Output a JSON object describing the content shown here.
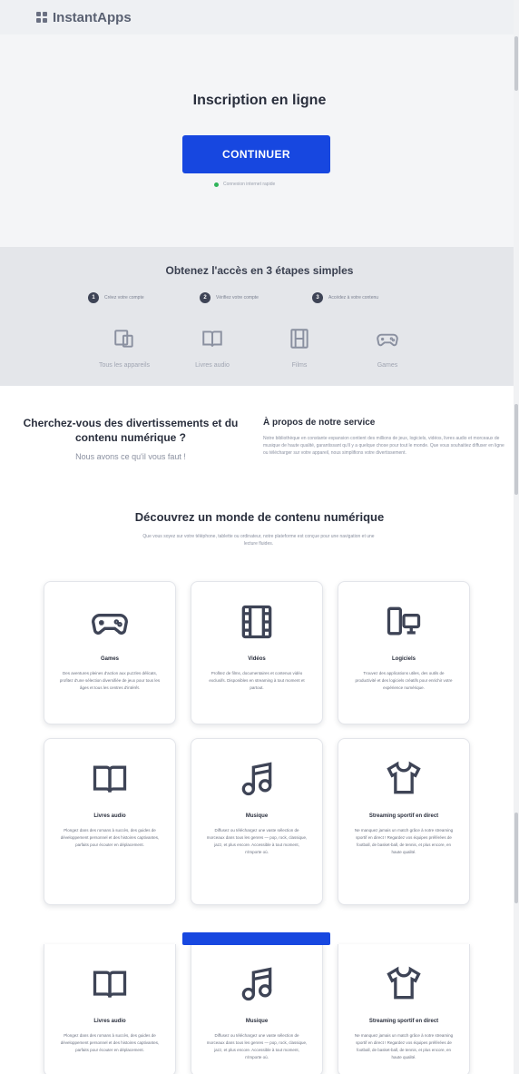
{
  "app": {
    "name": "InstantApps"
  },
  "hero": {
    "title": "Inscription en ligne",
    "cta_label": "CONTINUER",
    "status_text": "Connexion internet rapide"
  },
  "steps": {
    "title": "Obtenez l'accès en 3 étapes simples",
    "items": [
      {
        "num": "1",
        "label": "Créez votre compte"
      },
      {
        "num": "2",
        "label": "Vérifiez votre compte"
      },
      {
        "num": "3",
        "label": "Accédez à votre contenu"
      }
    ],
    "categories": [
      {
        "label": "Tous les appareils",
        "icon": "devices-icon"
      },
      {
        "label": "Livres audio",
        "icon": "book-icon"
      },
      {
        "label": "Films",
        "icon": "film-icon"
      },
      {
        "label": "Games",
        "icon": "gamepad-icon"
      }
    ]
  },
  "intro": {
    "title": "Cherchez-vous des divertissements et du contenu numérique ?",
    "subtitle": "Nous avons ce qu'il vous faut !",
    "about_title": "À propos de notre service",
    "about_text": "Notre bibliothèque en constante expansion contient des millions de jeux, logiciels, vidéos, livres audio et morceaux de musique de haute qualité, garantissant qu'il y a quelque chose pour tout le monde. Que vous souhaitiez diffuser en ligne ou télécharger sur votre appareil, nous simplifions votre divertissement."
  },
  "discover": {
    "title": "Découvrez un monde de contenu numérique",
    "subtitle": "Que vous soyez sur votre téléphone, tablette ou ordinateur, notre plateforme est conçue pour une navigation et une lecture fluides."
  },
  "cards": [
    {
      "icon": "gamepad-icon",
      "title": "Games",
      "text": "Des aventures pleines d'action aux puzzles délicats, profitez d'une sélection diversifiée de jeux pour tous les âges et tous les centres d'intérêt."
    },
    {
      "icon": "film-icon",
      "title": "Vidéos",
      "text": "Profitez de films, documentaires et contenus vidéo exclusifs. Disponibles en streaming à tout moment et partout."
    },
    {
      "icon": "devices-icon",
      "title": "Logiciels",
      "text": "Trouvez des applications utiles, des outils de productivité et des logiciels créatifs pour enrichir votre expérience numérique."
    },
    {
      "icon": "book-icon",
      "title": "Livres audio",
      "text": "Plongez dans des romans à succès, des guides de développement personnel et des histoires captivantes, parfaits pour écouter en déplacement."
    },
    {
      "icon": "music-icon",
      "title": "Musique",
      "text": "Diffusez ou téléchargez une vaste sélection de morceaux dans tous les genres — pop, rock, classique, jazz, et plus encore. Accessible à tout moment, n'importe où."
    },
    {
      "icon": "shirt-icon",
      "title": "Streaming sportif en direct",
      "text": "Ne manquez jamais un match grâce à notre streaming sportif en direct ! Regardez vos équipes préférées de football, de basket-ball, de tennis, et plus encore, en haute qualité."
    },
    {
      "icon": "book-icon",
      "title": "Livres audio",
      "text": "Plongez dans des romans à succès, des guides de développement personnel et des histoires captivantes, parfaits pour écouter en déplacement."
    },
    {
      "icon": "music-icon",
      "title": "Musique",
      "text": "Diffusez ou téléchargez une vaste sélection de morceaux dans tous les genres — pop, rock, classique, jazz, et plus encore. Accessible à tout moment, n'importe où."
    },
    {
      "icon": "shirt-icon",
      "title": "Streaming sportif en direct",
      "text": "Ne manquez jamais un match grâce à notre streaming sportif en direct ! Regardez vos équipes préférées de football, de basket-ball, de tennis, et plus encore, en haute qualité."
    }
  ],
  "colors": {
    "accent": "#1747e0",
    "status": "#2fb45a",
    "hero_bg": "#f4f5f7",
    "steps_bg": "#e4e6ea"
  }
}
